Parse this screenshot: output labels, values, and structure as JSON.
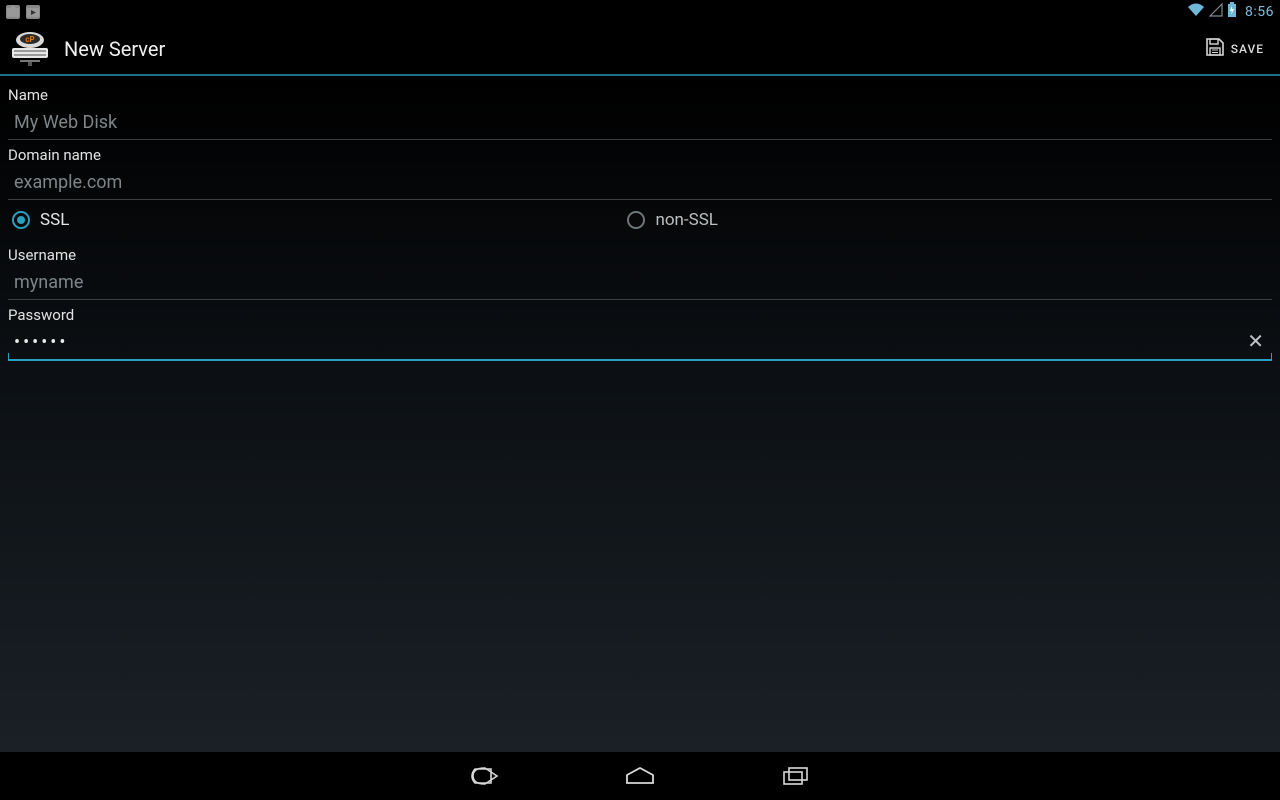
{
  "statusbar": {
    "time": "8:56"
  },
  "header": {
    "title": "New Server",
    "save_label": "SAVE"
  },
  "form": {
    "name_label": "Name",
    "name_placeholder": "My Web Disk",
    "name_value": "",
    "domain_label": "Domain name",
    "domain_placeholder": "example.com",
    "domain_value": "",
    "ssl_label": "SSL",
    "nonssl_label": "non-SSL",
    "ssl_selected": "SSL",
    "username_label": "Username",
    "username_placeholder": "myname",
    "username_value": "",
    "password_label": "Password",
    "password_value": "••••••",
    "clear_glyph": "✕"
  }
}
